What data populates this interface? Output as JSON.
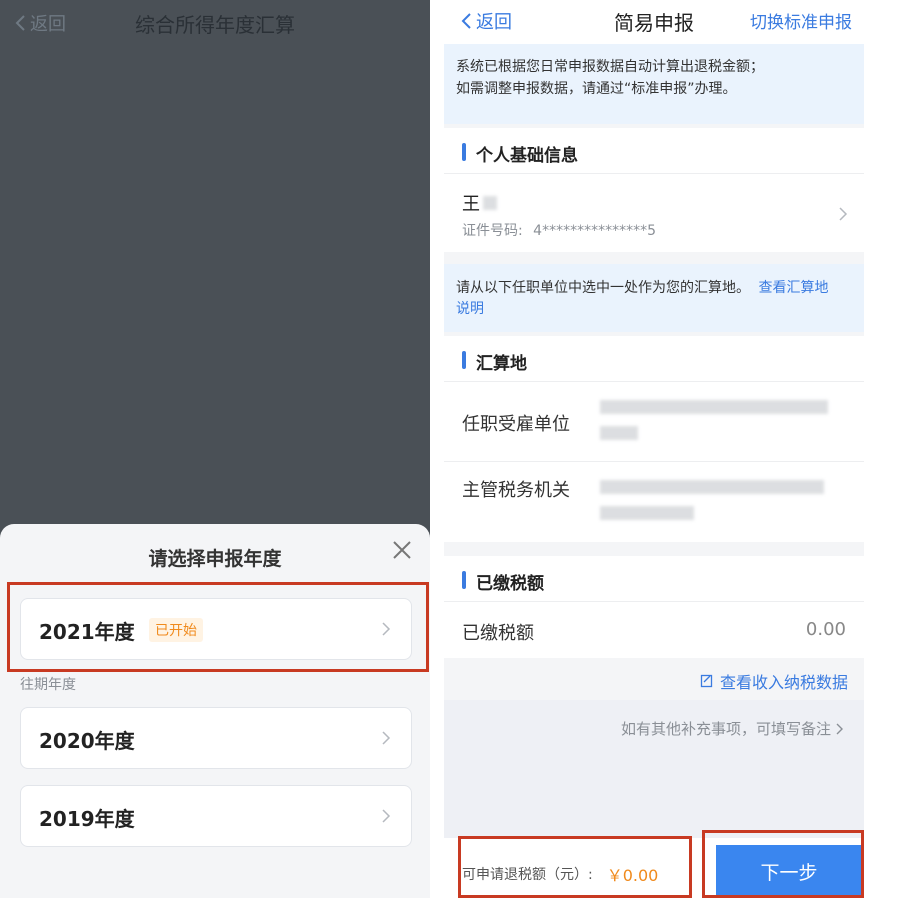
{
  "left": {
    "back_label": "返回",
    "title": "综合所得年度汇算",
    "sheet": {
      "title": "请选择申报年度",
      "current": {
        "label": "2021年度",
        "badge": "已开始"
      },
      "past_label": "往期年度",
      "past": [
        {
          "label": "2020年度"
        },
        {
          "label": "2019年度"
        }
      ]
    }
  },
  "right": {
    "back_label": "返回",
    "title": "简易申报",
    "switch_label": "切换标准申报",
    "notice_line1": "系统已根据您日常申报数据自动计算出退税金额；",
    "notice_line2": "如需调整申报数据，请通过“标准申报”办理。",
    "personal": {
      "section_title": "个人基础信息",
      "name": "王",
      "id_label": "证件号码:",
      "id_value": "4***************5"
    },
    "location_notice": "请从以下任职单位中选中一处作为您的汇算地。",
    "location_link_1": "查看汇算地",
    "location_link_2": "说明",
    "location": {
      "section_title": "汇算地",
      "employer_label": "任职受雇单位",
      "tax_office_label": "主管税务机关"
    },
    "paid": {
      "section_title": "已缴税额",
      "label": "已缴税额",
      "value": "0.00",
      "link": "查看收入纳税数据"
    },
    "remark_placeholder": "如有其他补充事项，可填写备注",
    "refund": {
      "label": "可申请退税额（元）:",
      "value": "￥0.00"
    },
    "next_label": "下一步"
  },
  "colors": {
    "accent_blue": "#3a7be0",
    "badge_orange": "#f08a1c",
    "highlight_red": "#c83a22",
    "overlay_gray": "#4a5056"
  }
}
